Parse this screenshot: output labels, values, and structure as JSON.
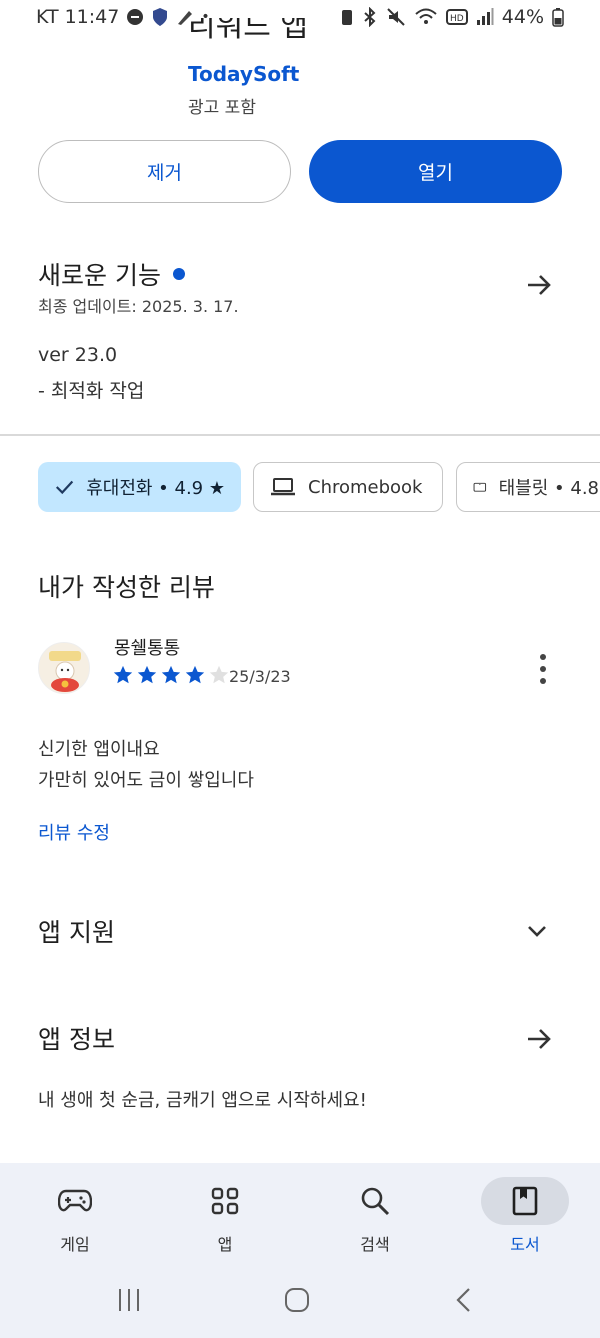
{
  "status_bar": {
    "carrier": "KT",
    "time": "11:47",
    "battery": "44%"
  },
  "app": {
    "title_partial": "리워드 앱",
    "developer": "TodaySoft",
    "ad_note": "광고 포함"
  },
  "actions": {
    "remove_label": "제거",
    "open_label": "열기"
  },
  "whats_new": {
    "title": "새로운 기능",
    "updated": "최종 업데이트: 2025. 3. 17.",
    "version": "ver 23.0",
    "changes": "- 최적화 작업"
  },
  "device_chips": [
    {
      "label": "휴대전화 • 4.9 ★",
      "selected": true
    },
    {
      "label": "Chromebook",
      "selected": false
    },
    {
      "label": "태블릿 • 4.8",
      "selected": false
    }
  ],
  "my_review": {
    "title": "내가 작성한 리뷰",
    "reviewer": "몽쉘통통",
    "rating": 4,
    "max_rating": 5,
    "date": "25/3/23",
    "text_line1": "신기한 앱이내요",
    "text_line2": "가만히 있어도 금이 쌓입니다",
    "edit_label": "리뷰 수정"
  },
  "app_support": {
    "title": "앱 지원"
  },
  "about": {
    "title": "앱 정보",
    "description": "내 생애 첫 순금, 금캐기 앱으로 시작하세요!"
  },
  "bottom_nav": {
    "items": [
      {
        "label": "게임",
        "icon": "gamepad-icon",
        "active": false
      },
      {
        "label": "앱",
        "icon": "apps-grid-icon",
        "active": false
      },
      {
        "label": "검색",
        "icon": "search-icon",
        "active": false
      },
      {
        "label": "도서",
        "icon": "book-icon",
        "active": true
      }
    ]
  },
  "colors": {
    "accent": "#0b57d0",
    "chip_selected_bg": "#c2e7ff",
    "nav_bg": "#eef1f8",
    "star": "#0b57d0"
  }
}
